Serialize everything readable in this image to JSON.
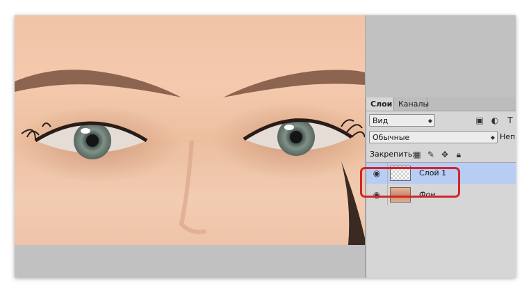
{
  "canvas": {
    "image_description_icon": "eyes-photo"
  },
  "panel": {
    "tabs": [
      {
        "label": "Слои"
      },
      {
        "label": "Каналы"
      }
    ],
    "filter": {
      "label": "Вид"
    },
    "blend_mode": {
      "value": "Обычные"
    },
    "opacity_label": "Неп",
    "lock_label": "Закрепить:",
    "layers": [
      {
        "name": "Слой 1",
        "selected": true,
        "thumbnail": "transparent"
      },
      {
        "name": "Фон",
        "selected": false,
        "thumbnail": "photo"
      }
    ]
  },
  "colors": {
    "selection": "#b8cdf4",
    "highlight_border": "#d0262d",
    "panel_bg": "#d6d6d6"
  }
}
